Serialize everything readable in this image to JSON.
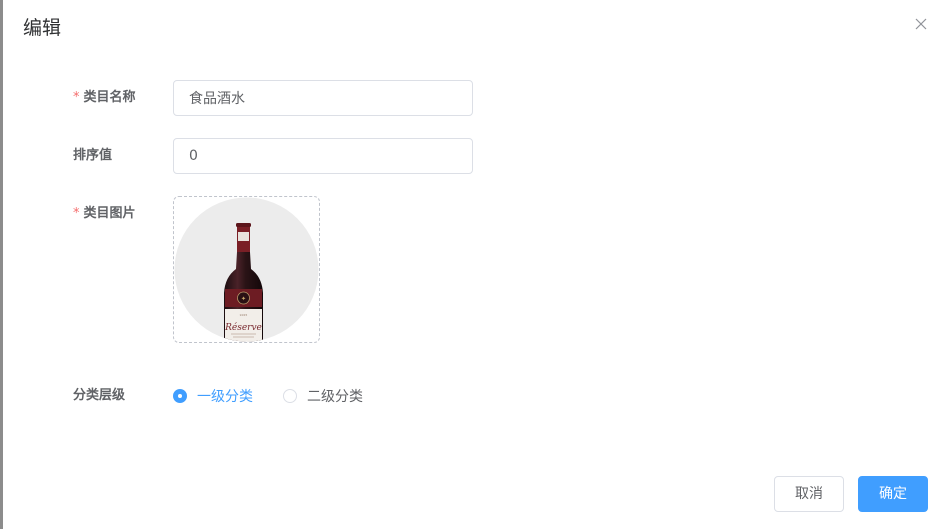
{
  "dialog": {
    "title": "编辑",
    "close_icon": "close-icon"
  },
  "form": {
    "category_name": {
      "label": "类目名称",
      "required_mark": "*",
      "value": "食品酒水"
    },
    "sort_value": {
      "label": "排序值",
      "value": "0"
    },
    "category_image": {
      "label": "类目图片",
      "required_mark": "*",
      "image_icon": "wine-bottle-icon",
      "bottle_label_text": "Réserve"
    },
    "level": {
      "label": "分类层级",
      "options": [
        {
          "label": "一级分类",
          "checked": true
        },
        {
          "label": "二级分类",
          "checked": false
        }
      ]
    }
  },
  "footer": {
    "cancel_label": "取消",
    "confirm_label": "确定"
  },
  "colors": {
    "primary": "#409eff",
    "required": "#f56c6c",
    "border": "#dcdfe6"
  }
}
